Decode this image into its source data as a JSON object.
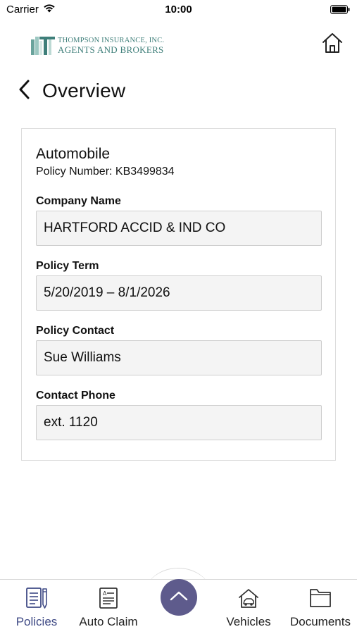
{
  "status_bar": {
    "carrier": "Carrier",
    "time": "10:00"
  },
  "header": {
    "logo_line1": "THOMPSON INSURANCE, INC.",
    "logo_line2": "AGENTS AND BROKERS",
    "home_icon": "home-icon"
  },
  "page": {
    "back_icon": "chevron-left-icon",
    "title": "Overview"
  },
  "policy": {
    "type": "Automobile",
    "policy_number": "Policy Number: KB3499834",
    "fields": [
      {
        "label": "Company Name",
        "value": "HARTFORD ACCID & IND CO"
      },
      {
        "label": "Policy Term",
        "value": "5/20/2019 – 8/1/2026"
      },
      {
        "label": "Policy Contact",
        "value": "Sue Williams"
      },
      {
        "label": "Contact Phone",
        "value": "ext. 1120"
      }
    ]
  },
  "tab_bar": {
    "tabs": [
      {
        "label": "Policies",
        "icon": "policies-icon",
        "active": true
      },
      {
        "label": "Auto Claim",
        "icon": "auto-claim-icon",
        "active": false
      },
      {
        "label": "Vehicles",
        "icon": "vehicles-icon",
        "active": false
      },
      {
        "label": "Documents",
        "icon": "documents-icon",
        "active": false
      }
    ],
    "center_button_icon": "chevron-up-icon"
  },
  "colors": {
    "brand_teal": "#3f7f7a",
    "accent_purple": "#5e5b8c",
    "active_tab": "#3f4a85"
  }
}
